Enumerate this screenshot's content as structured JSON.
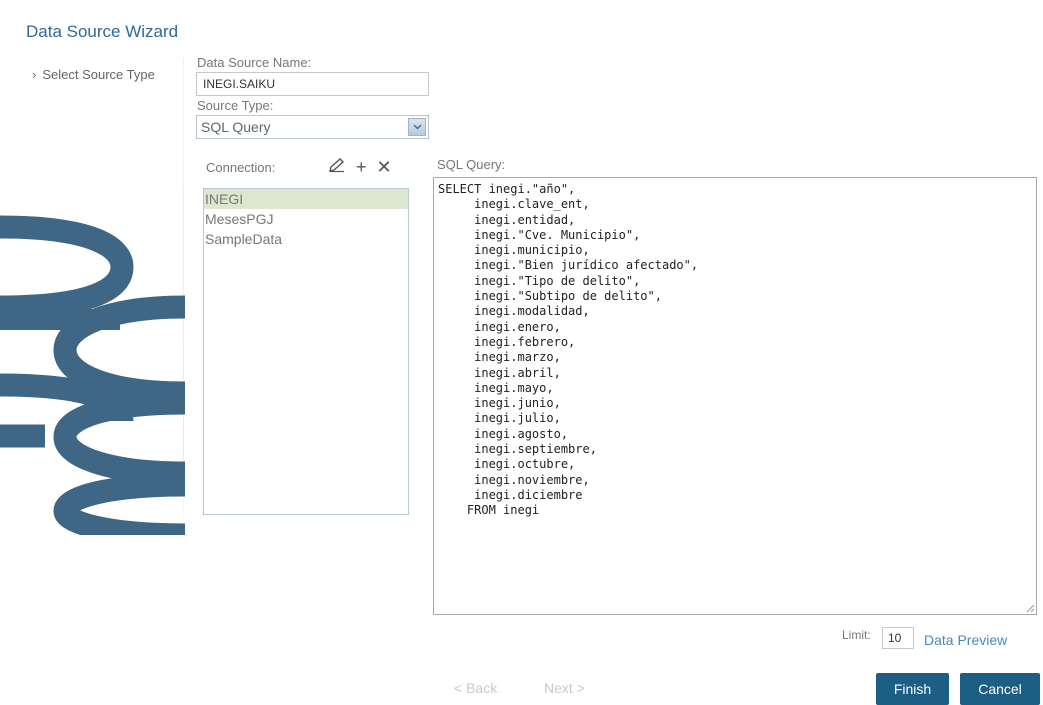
{
  "wizard": {
    "title": "Data Source Wizard"
  },
  "steps": [
    {
      "label": "Select Source Type"
    }
  ],
  "form": {
    "name_label": "Data Source Name:",
    "name_value": "INEGI.SAIKU",
    "type_label": "Source Type:",
    "type_value": "SQL Query",
    "connection_label": "Connection:",
    "connections": [
      "INEGI",
      "MesesPGJ",
      "SampleData"
    ],
    "selected_connection": "INEGI",
    "query_label": "SQL Query:",
    "query_text": "SELECT inegi.\"año\",\n     inegi.clave_ent,\n     inegi.entidad,\n     inegi.\"Cve. Municipio\",\n     inegi.municipio,\n     inegi.\"Bien jurídico afectado\",\n     inegi.\"Tipo de delito\",\n     inegi.\"Subtipo de delito\",\n     inegi.modalidad,\n     inegi.enero,\n     inegi.febrero,\n     inegi.marzo,\n     inegi.abril,\n     inegi.mayo,\n     inegi.junio,\n     inegi.julio,\n     inegi.agosto,\n     inegi.septiembre,\n     inegi.octubre,\n     inegi.noviembre,\n     inegi.diciembre\n    FROM inegi",
    "limit_label": "Limit:",
    "limit_value": "10",
    "preview_label": "Data Preview"
  },
  "footer": {
    "back_label": "< Back",
    "next_label": "Next >",
    "finish_label": "Finish",
    "cancel_label": "Cancel"
  },
  "icons": {
    "step": "chevron-right-icon",
    "edit": "pencil-icon",
    "add": "plus-icon",
    "remove": "close-icon",
    "dropdown": "chevron-down-icon",
    "logo": "database-icon"
  },
  "colors": {
    "title": "#2b6a98",
    "primary_button": "#1d5e84",
    "logo": "#3f6685",
    "selected_row": "#dde7cf",
    "link": "#4a8ab8"
  }
}
